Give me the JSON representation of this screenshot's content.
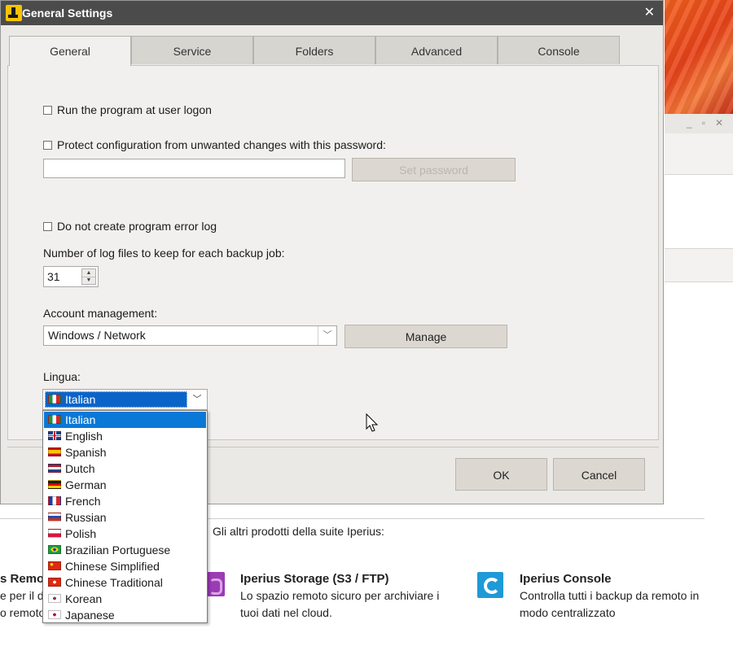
{
  "dialog": {
    "title": "General Settings",
    "close_glyph": "✕"
  },
  "tabs": [
    {
      "label": "General",
      "active": true
    },
    {
      "label": "Service",
      "active": false
    },
    {
      "label": "Folders",
      "active": false
    },
    {
      "label": "Advanced",
      "active": false
    },
    {
      "label": "Console",
      "active": false
    }
  ],
  "general": {
    "run_at_logon_label": "Run the program at user logon",
    "protect_config_label": "Protect configuration from unwanted changes with this password:",
    "password_value": "",
    "set_password_label": "Set password",
    "no_error_log_label": "Do not create program error log",
    "log_files_label": "Number of log files to keep for each backup job:",
    "log_files_value": "31",
    "account_label": "Account management:",
    "account_value": "Windows / Network",
    "manage_label": "Manage",
    "language_label": "Lingua:",
    "language_value": "Italian",
    "language_options": [
      {
        "label": "Italian",
        "flag": "it"
      },
      {
        "label": "English",
        "flag": "gb"
      },
      {
        "label": "Spanish",
        "flag": "es"
      },
      {
        "label": "Dutch",
        "flag": "nl"
      },
      {
        "label": "German",
        "flag": "de"
      },
      {
        "label": "French",
        "flag": "fr"
      },
      {
        "label": "Russian",
        "flag": "ru"
      },
      {
        "label": "Polish",
        "flag": "pl"
      },
      {
        "label": "Brazilian Portuguese",
        "flag": "br"
      },
      {
        "label": "Chinese Simplified",
        "flag": "cn"
      },
      {
        "label": "Chinese Traditional",
        "flag": "hk"
      },
      {
        "label": "Korean",
        "flag": "kr"
      },
      {
        "label": "Japanese",
        "flag": "jp"
      }
    ]
  },
  "footer": {
    "ok_label": "OK",
    "cancel_label": "Cancel"
  },
  "background": {
    "suite_label": "Gli altri prodotti della suite Iperius:",
    "product1": {
      "title": "s Remot",
      "desc1": "e per il de",
      "desc2": "o remoto"
    },
    "product2": {
      "title": "Iperius Storage (S3 / FTP)",
      "desc1": "Lo spazio remoto sicuro per archiviare i",
      "desc2": "tuoi dati nel cloud."
    },
    "product3": {
      "title": "Iperius Console",
      "desc1": "Controlla tutti i backup da remoto in",
      "desc2": "modo centralizzato"
    }
  },
  "colors": {
    "selection": "#0a78d7",
    "dialog_bg": "#ebe9e5",
    "titlebar": "#4b4b4b"
  }
}
